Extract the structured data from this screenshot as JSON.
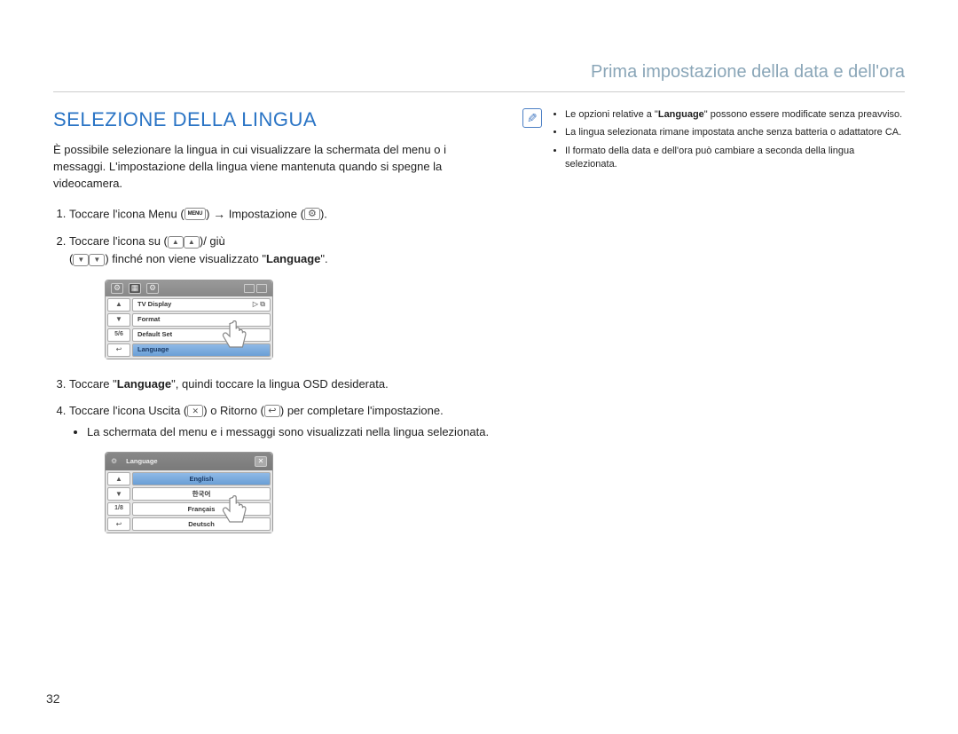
{
  "breadcrumb": "Prima impostazione della data e dell'ora",
  "section_title": "SELEZIONE DELLA LINGUA",
  "intro": "È possibile selezionare la lingua in cui visualizzare la schermata del menu o i messaggi. L'impostazione della lingua viene mantenuta quando si spegne la videocamera.",
  "step1_a": "Toccare l'icona Menu (",
  "step1_menu": "MENU",
  "step1_b": ") ",
  "step1_arrow": "→",
  "step1_c": " Impostazione (",
  "step1_d": ").",
  "step2_a": "Toccare l'icona su (",
  "step2_b": ")/ giù",
  "step2_c": "(",
  "step2_d": ") finché non viene visualizzato \"",
  "step2_lang": "Language",
  "step2_e": "\".",
  "step3_a": "Toccare \"",
  "step3_lang": "Language",
  "step3_b": "\", quindi toccare la lingua OSD desiderata.",
  "step4_a": "Toccare l'icona Uscita (",
  "step4_b": ") o Ritorno (",
  "step4_c": ") per completare l'impostazione.",
  "step4_bullet": "La schermata del menu e i messaggi sono visualizzati nella lingua selezionata.",
  "notes": [
    "Le opzioni relative a \"Language\" possono essere modificate senza preavviso.",
    "La lingua selezionata rimane impostata anche senza batteria o adattatore CA.",
    "Il formato della data e dell'ora può cambiare a seconda della lingua selezionata."
  ],
  "notes_bold": "Language",
  "device1": {
    "page": "5/6",
    "rows": [
      "TV Display",
      "Format",
      "Default Set",
      "Language"
    ]
  },
  "device2": {
    "title": "Language",
    "page": "1/8",
    "rows": [
      "English",
      "한국어",
      "Français",
      "Deutsch"
    ]
  },
  "page_number": "32"
}
